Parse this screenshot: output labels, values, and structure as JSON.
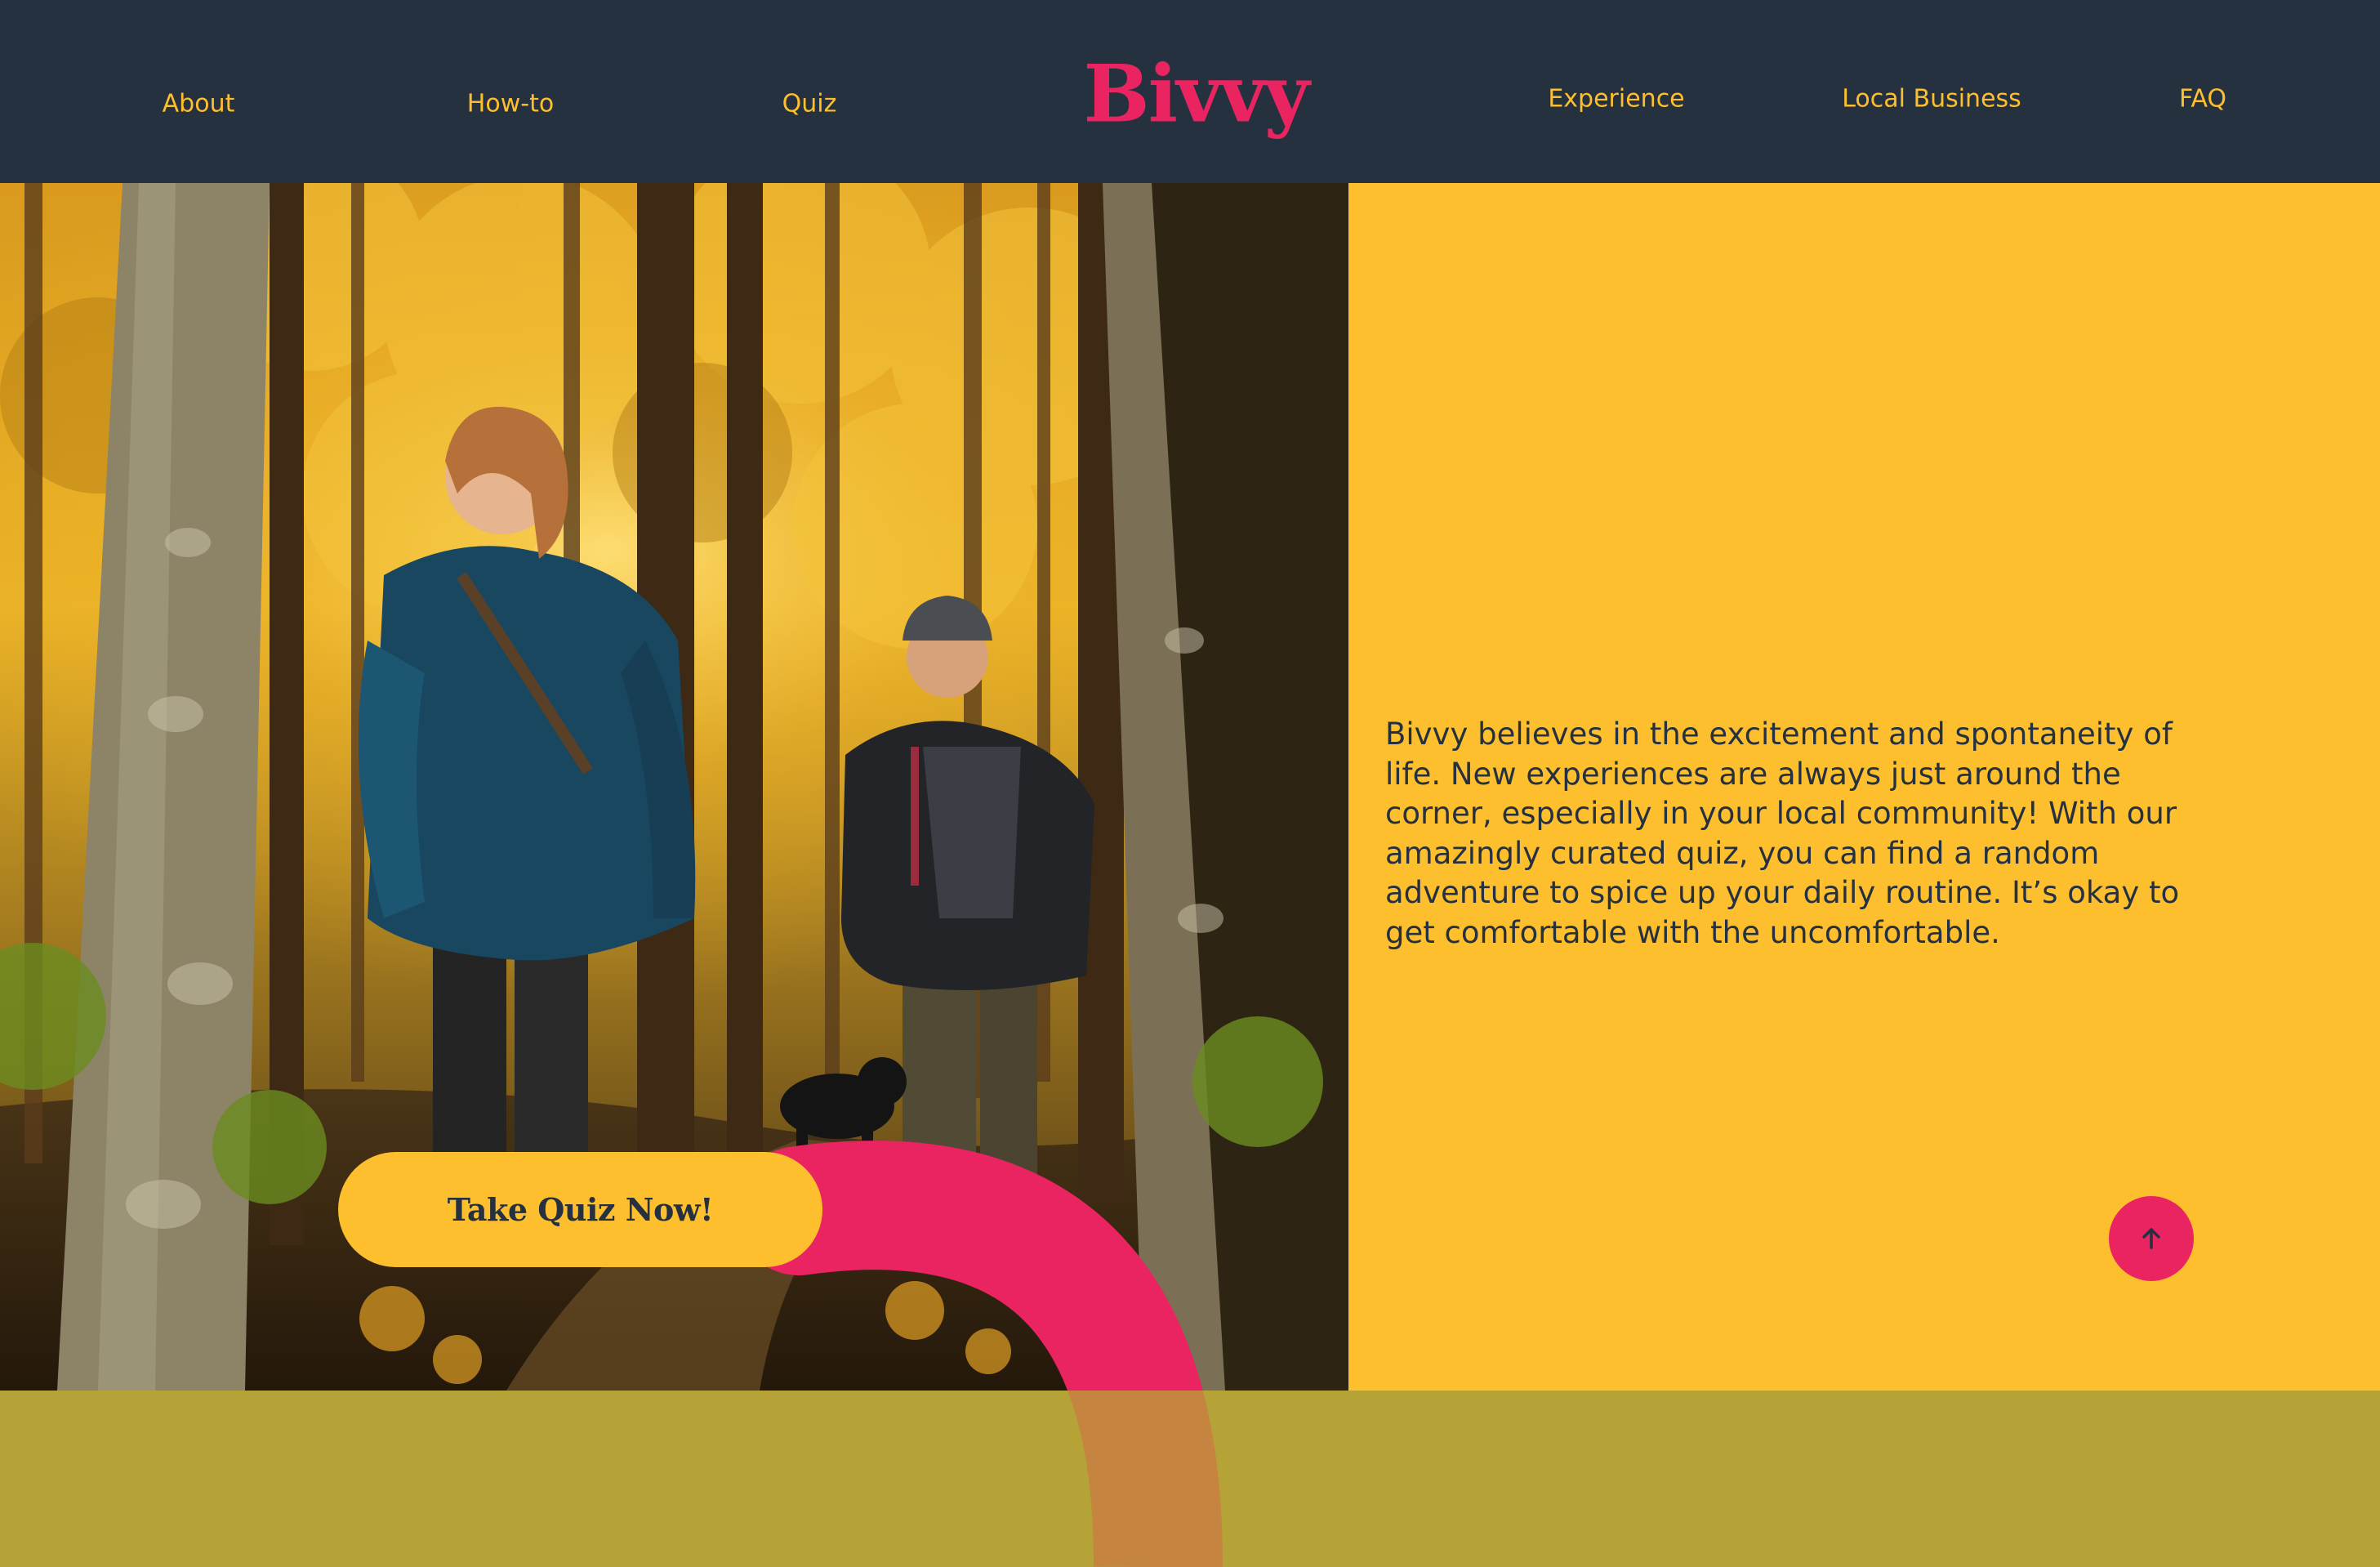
{
  "header": {
    "logo_text": "Bivvy",
    "nav_left": [
      {
        "label": "About"
      },
      {
        "label": "How-to"
      },
      {
        "label": "Quiz"
      }
    ],
    "nav_right": [
      {
        "label": "Experience"
      },
      {
        "label": "Local Business"
      },
      {
        "label": "FAQ"
      }
    ]
  },
  "hero": {
    "cta_label": "Take Quiz Now!",
    "intro_text": "Bivvy believes in the excitement and spontaneity of life. New experiences are always just around the corner, especially in your local community! With our amazingly curated quiz, you can find a random adventure to spice up your daily routine. It’s okay to get comfortable with the uncomfortable."
  },
  "icons": {
    "scroll_top": "arrow-up-icon"
  },
  "colors": {
    "header_bg": "#263140",
    "accent_yellow": "#FDBF2D",
    "brand_pink": "#EA2460",
    "band_olive": "#B5A338",
    "curve_orange": "#C5843F"
  }
}
